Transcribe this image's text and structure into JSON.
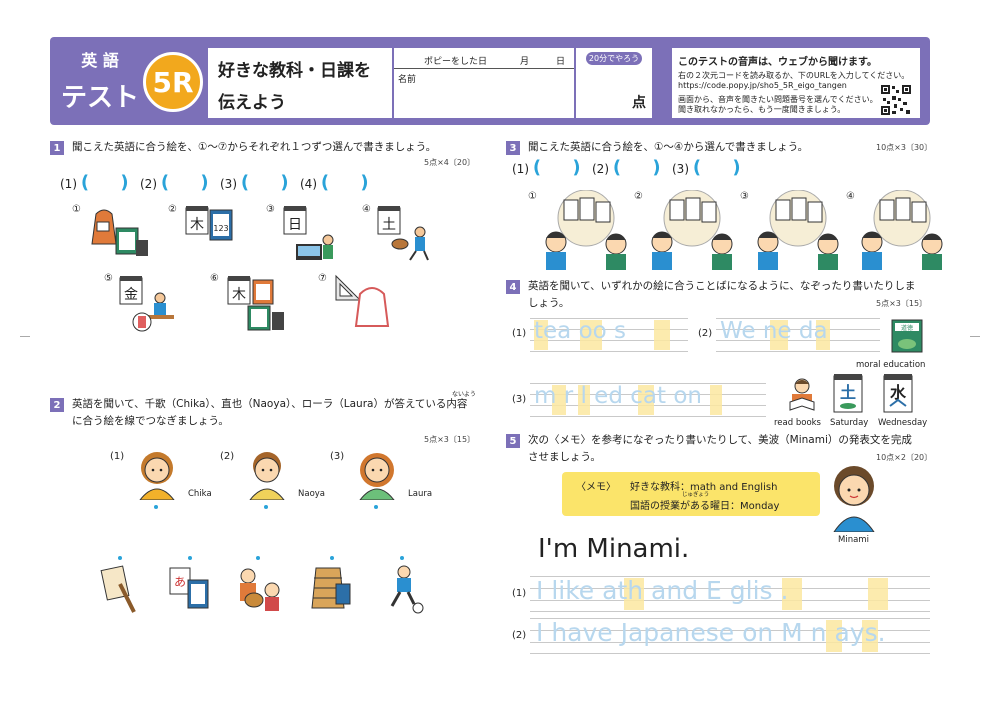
{
  "header": {
    "subject_line1": "英 語",
    "subject_line2": "テスト",
    "badge": "5R",
    "title_line1": "好きな教科・日課を",
    "title_line2": "伝えよう",
    "copy_label": "ポピーをした日",
    "month": "月",
    "day": "日",
    "name_label": "名前",
    "time_badge": "20分でやろう",
    "score_label": "点",
    "audio_title": "このテストの音声は、ウェブから聞けます。",
    "audio_line1": "右の２次元コードを読み取るか、下のURLを入力してください。",
    "audio_url": "https://code.popy.jp/sho5_5R_eigo_tangen",
    "audio_line2": "画面から、音声を聞きたい問題番号を選んでください。",
    "audio_line3": "聞き取れなかったら、もう一度聞きましょう。"
  },
  "q1": {
    "num": "1",
    "text": "聞こえた英語に合う絵を、①～⑦からそれぞれ１つずつ選んで書きましょう。",
    "points": "5点×4〔20〕",
    "answers": [
      "(1)",
      "(2)",
      "(3)",
      "(4)"
    ],
    "options": [
      "①",
      "②",
      "③",
      "④",
      "⑤",
      "⑥",
      "⑦"
    ],
    "kanji": {
      "k2": "木",
      "k3": "日",
      "k4": "土",
      "k5": "金",
      "k6": "木"
    }
  },
  "q2": {
    "num": "2",
    "text1": "英語を聞いて、千歌（Chika）、直也（Naoya）、ローラ（Laura）が答えている内容",
    "text2": "に合う絵を線でつなぎましょう。",
    "ruby": "ないよう",
    "points": "5点×3〔15〕",
    "people": [
      {
        "num": "(1)",
        "name": "Chika"
      },
      {
        "num": "(2)",
        "name": "Naoya"
      },
      {
        "num": "(3)",
        "name": "Laura"
      }
    ]
  },
  "q3": {
    "num": "3",
    "text": "聞こえた英語に合う絵を、①～④から選んで書きましょう。",
    "points": "10点×3〔30〕",
    "answers": [
      "(1)",
      "(2)",
      "(3)"
    ],
    "options": [
      "①",
      "②",
      "③",
      "④"
    ]
  },
  "q4": {
    "num": "4",
    "text1": "英語を聞いて、いずれかの絵に合うことばになるように、なぞったり書いたりしま",
    "text2": "しょう。",
    "points": "5点×3〔15〕",
    "rows": [
      {
        "num": "(1)",
        "trace": "tea  oo s"
      },
      {
        "num": "(2)",
        "trace": "We  ne  da"
      },
      {
        "num": "(3)",
        "trace": "m r l ed cat on"
      }
    ],
    "labels": {
      "book_label": "道徳",
      "moral": "moral education",
      "read": "read books",
      "sat": "Saturday",
      "wed": "Wednesday",
      "sat_kanji": "土",
      "wed_kanji": "水"
    }
  },
  "q5": {
    "num": "5",
    "text1": "次の〈メモ〉を参考になぞったり書いたりして、美波（Minami）の発表文を完成",
    "text2": "させましょう。",
    "points": "10点×2〔20〕",
    "memo_label": "〈メモ〉",
    "memo_line1": "好きな教科：math and English",
    "memo_line2": "国語の授業がある曜日：Monday",
    "memo_ruby": "じゅぎょう",
    "intro": "I'm Minami.",
    "minami": "Minami",
    "rows": [
      {
        "num": "(1)",
        "trace": "I like  ath and E glis  ."
      },
      {
        "num": "(2)",
        "trace": "I have Japanese on M  n  ays."
      }
    ]
  },
  "colors": {
    "accent": "#7c70b8",
    "badge": "#f2a81d",
    "answer": "#2aa3d9",
    "trace": "#b7d7ee",
    "highlight": "#fbe8a0"
  }
}
